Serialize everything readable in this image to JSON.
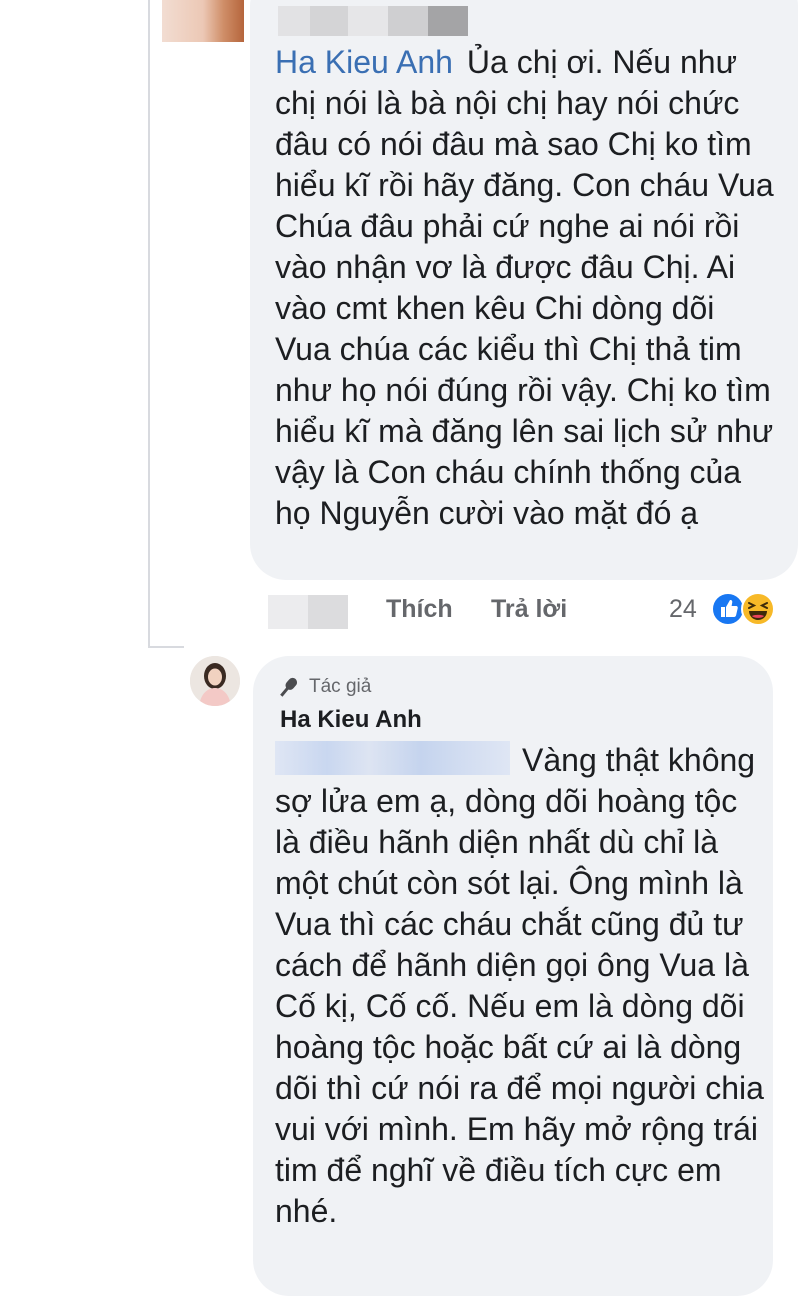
{
  "comment1": {
    "author": "Ha Kieu Anh",
    "text": "Ủa chị ơi. Nếu như chị nói là bà nội chị hay nói chức đâu có nói đâu mà sao Chị ko tìm hiểu kĩ rồi hãy đăng. Con cháu Vua Chúa đâu phải cứ nghe ai nói rồi vào nhận vơ là được đâu Chị. Ai vào cmt khen kêu Chi dòng dõi Vua chúa các kiểu thì Chị thả tim như họ nói đúng rồi vậy. Chị ko tìm hiểu kĩ mà đăng lên sai lịch sử như vậy là Con cháu chính thống của họ Nguyễn cười vào mặt đó ạ",
    "actions": {
      "like": "Thích",
      "reply": "Trả lời"
    },
    "reaction_count": "24",
    "reactions": [
      "like-icon",
      "haha-icon"
    ]
  },
  "reply": {
    "badge": "Tác giả",
    "author": "Ha Kieu Anh",
    "text": "Vàng thật không sợ lửa em ạ, dòng dõi hoàng tộc là điều hãnh diện nhất dù chỉ là một chút còn sót lại. Ông mình là Vua thì các cháu chắt cũng đủ tư cách để hãnh diện gọi ông Vua là Cố kị, Cố cố. Nếu em là dòng dõi hoàng tộc hoặc bất cứ ai là dòng dõi thì cứ nói ra để mọi người chia vui với mình. Em hãy mở rộng trái tim để nghĩ về điều tích cực em nhé."
  },
  "colors": {
    "author_link": "#3a6fb3",
    "bubble_bg": "#f0f2f5",
    "like_blue": "#1877f2",
    "haha_yellow": "#f7b928"
  }
}
